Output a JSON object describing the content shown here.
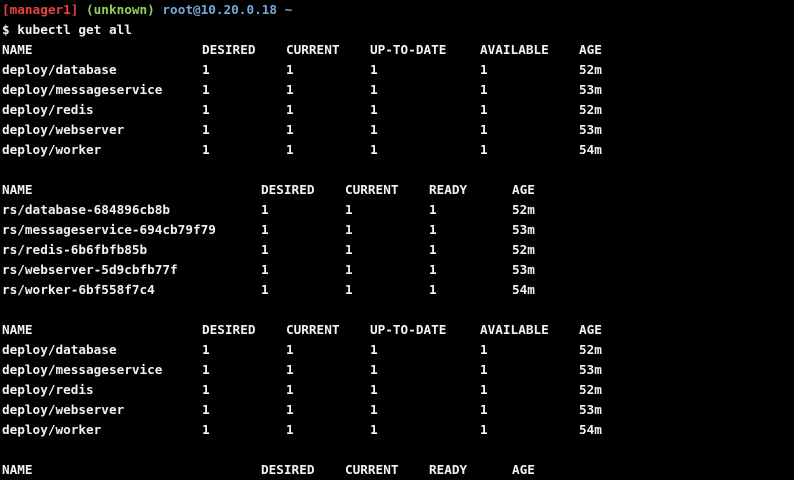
{
  "prompt": {
    "host": "[manager1]",
    "branch": "(unknown)",
    "user_at_host": "root@10.20.0.18",
    "cwd": "~",
    "symbol": "$",
    "command": "kubectl get all"
  },
  "colors": {
    "background": "#000000",
    "text": "#f2f2f2",
    "host": "#e8423e",
    "branch": "#8ed25d",
    "user": "#7aa6da"
  },
  "deploy_headers": [
    "NAME",
    "DESIRED",
    "CURRENT",
    "UP-TO-DATE",
    "AVAILABLE",
    "AGE"
  ],
  "rs_headers": [
    "NAME",
    "DESIRED",
    "CURRENT",
    "READY",
    "AGE"
  ],
  "deploy_table_1": [
    [
      "deploy/database",
      "1",
      "1",
      "1",
      "1",
      "52m"
    ],
    [
      "deploy/messageservice",
      "1",
      "1",
      "1",
      "1",
      "53m"
    ],
    [
      "deploy/redis",
      "1",
      "1",
      "1",
      "1",
      "52m"
    ],
    [
      "deploy/webserver",
      "1",
      "1",
      "1",
      "1",
      "53m"
    ],
    [
      "deploy/worker",
      "1",
      "1",
      "1",
      "1",
      "54m"
    ]
  ],
  "rs_table_1": [
    [
      "rs/database-684896cb8b",
      "1",
      "1",
      "1",
      "52m"
    ],
    [
      "rs/messageservice-694cb79f79",
      "1",
      "1",
      "1",
      "53m"
    ],
    [
      "rs/redis-6b6fbfb85b",
      "1",
      "1",
      "1",
      "52m"
    ],
    [
      "rs/webserver-5d9cbfb77f",
      "1",
      "1",
      "1",
      "53m"
    ],
    [
      "rs/worker-6bf558f7c4",
      "1",
      "1",
      "1",
      "54m"
    ]
  ],
  "deploy_table_2": [
    [
      "deploy/database",
      "1",
      "1",
      "1",
      "1",
      "52m"
    ],
    [
      "deploy/messageservice",
      "1",
      "1",
      "1",
      "1",
      "53m"
    ],
    [
      "deploy/redis",
      "1",
      "1",
      "1",
      "1",
      "52m"
    ],
    [
      "deploy/webserver",
      "1",
      "1",
      "1",
      "1",
      "53m"
    ],
    [
      "deploy/worker",
      "1",
      "1",
      "1",
      "1",
      "54m"
    ]
  ]
}
